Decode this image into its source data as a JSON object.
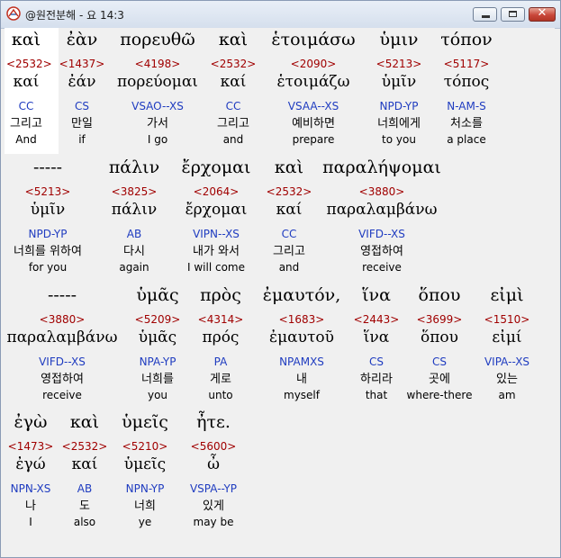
{
  "window": {
    "title": "@원전분해 - 요 14:3"
  },
  "rows": [
    {
      "words": [
        {
          "greek": "καὶ",
          "strongs": "<2532>",
          "lemma": "καί",
          "morph": "CC",
          "korean": "그리고",
          "english": "And"
        },
        {
          "greek": "ἐὰν",
          "strongs": "<1437>",
          "lemma": "ἐάν",
          "morph": "CS",
          "korean": "만일",
          "english": "if"
        },
        {
          "greek": "πορευθῶ",
          "strongs": "<4198>",
          "lemma": "πορεύομαι",
          "morph": "VSAO--XS",
          "korean": "가서",
          "english": "I go"
        },
        {
          "greek": "καὶ",
          "strongs": "<2532>",
          "lemma": "καί",
          "morph": "CC",
          "korean": "그리고",
          "english": "and"
        },
        {
          "greek": "ἑτοιμάσω",
          "strongs": "<2090>",
          "lemma": "ἑτοιμάζω",
          "morph": "VSAA--XS",
          "korean": "예비하면",
          "english": "prepare"
        },
        {
          "greek": "ὑμιν",
          "strongs": "<5213>",
          "lemma": "ὑμῖν",
          "morph": "NPD-YP",
          "korean": "너희에게",
          "english": "to you"
        },
        {
          "greek": "τόπον",
          "strongs": "<5117>",
          "lemma": "τόπος",
          "morph": "N-AM-S",
          "korean": "처소를",
          "english": "a place"
        }
      ]
    },
    {
      "words": [
        {
          "greek": "-----",
          "strongs": "<5213>",
          "lemma": "ὑμῖν",
          "morph": "NPD-YP",
          "korean": "너희를 위하여",
          "english": "for you"
        },
        {
          "greek": "πάλιν",
          "strongs": "<3825>",
          "lemma": "πάλιν",
          "morph": "AB",
          "korean": "다시",
          "english": "again"
        },
        {
          "greek": "ἔρχομαι",
          "strongs": "<2064>",
          "lemma": "ἔρχομαι",
          "morph": "VIPN--XS",
          "korean": "내가 와서",
          "english": "I will come"
        },
        {
          "greek": "καὶ",
          "strongs": "<2532>",
          "lemma": "καί",
          "morph": "CC",
          "korean": "그리고",
          "english": "and"
        },
        {
          "greek": "παραλήψομαι",
          "strongs": "<3880>",
          "lemma": "παραλαμβάνω",
          "morph": "VIFD--XS",
          "korean": "영접하여",
          "english": "receive"
        }
      ]
    },
    {
      "words": [
        {
          "greek": "-----",
          "strongs": "<3880>",
          "lemma": "παραλαμβάνω",
          "morph": "VIFD--XS",
          "korean": "영접하여",
          "english": "receive"
        },
        {
          "greek": "ὑμᾶς",
          "strongs": "<5209>",
          "lemma": "ὑμᾶς",
          "morph": "NPA-YP",
          "korean": "너희를",
          "english": "you"
        },
        {
          "greek": "πρὸς",
          "strongs": "<4314>",
          "lemma": "πρός",
          "morph": "PA",
          "korean": "게로",
          "english": "unto"
        },
        {
          "greek": "ἐμαυτόν,",
          "strongs": "<1683>",
          "lemma": "ἐμαυτοῦ",
          "morph": "NPAMXS",
          "korean": "내",
          "english": "myself"
        },
        {
          "greek": "ἵνα",
          "strongs": "<2443>",
          "lemma": "ἵνα",
          "morph": "CS",
          "korean": "하리라",
          "english": "that"
        },
        {
          "greek": "ὅπου",
          "strongs": "<3699>",
          "lemma": "ὅπου",
          "morph": "CS",
          "korean": "곳에",
          "english": "where-there"
        },
        {
          "greek": "εἰμὶ",
          "strongs": "<1510>",
          "lemma": "εἰμί",
          "morph": "VIPA--XS",
          "korean": "있는",
          "english": "am"
        }
      ]
    },
    {
      "words": [
        {
          "greek": "ἐγὼ",
          "strongs": "<1473>",
          "lemma": "ἐγώ",
          "morph": "NPN-XS",
          "korean": "나",
          "english": "I"
        },
        {
          "greek": "καὶ",
          "strongs": "<2532>",
          "lemma": "καί",
          "morph": "AB",
          "korean": "도",
          "english": "also"
        },
        {
          "greek": "ὑμεῖς",
          "strongs": "<5210>",
          "lemma": "ὑμεῖς",
          "morph": "NPN-YP",
          "korean": "너희",
          "english": "ye"
        },
        {
          "greek": "ἦτε.",
          "strongs": "<5600>",
          "lemma": "ὦ",
          "morph": "VSPA--YP",
          "korean": "있게",
          "english": "may be"
        }
      ]
    }
  ]
}
